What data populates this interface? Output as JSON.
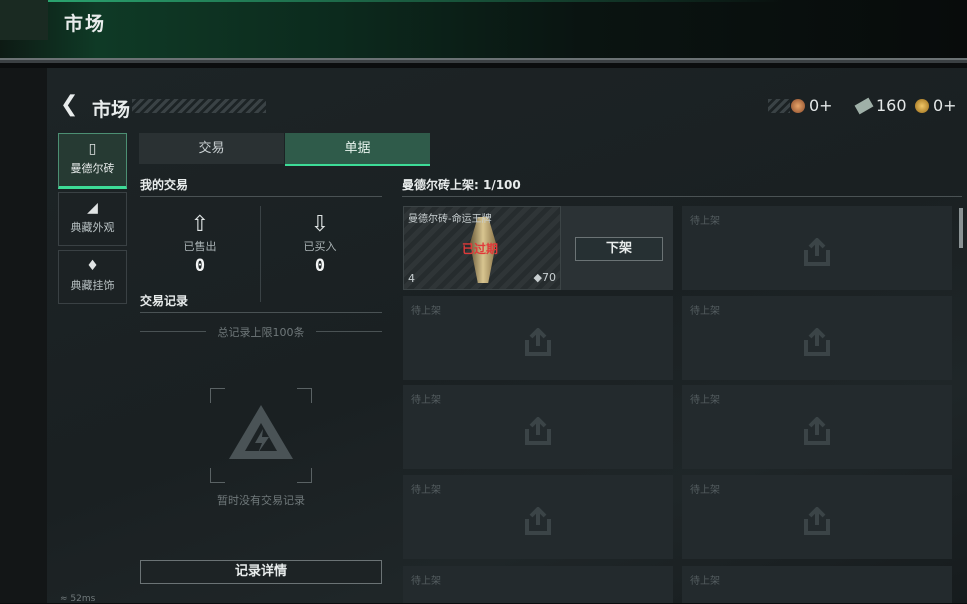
{
  "top": {
    "title": "市场"
  },
  "header": {
    "title": "市场"
  },
  "currency": [
    {
      "icon": "medal-coin-icon",
      "value": "0+"
    },
    {
      "icon": "ticket-icon",
      "value": "160"
    },
    {
      "icon": "gold-coin-icon",
      "value": "0+"
    }
  ],
  "sidebar": {
    "items": [
      {
        "label": "曼德尔砖",
        "icon": "brick-icon"
      },
      {
        "label": "典藏外观",
        "icon": "pistol-icon"
      },
      {
        "label": "典藏挂饰",
        "icon": "charm-icon"
      }
    ]
  },
  "tabs": [
    {
      "label": "交易"
    },
    {
      "label": "单据"
    }
  ],
  "my_trades": {
    "title": "我的交易",
    "sold_label": "已售出",
    "sold_value": "0",
    "bought_label": "已买入",
    "bought_value": "0"
  },
  "records": {
    "title": "交易记录",
    "limit": "总记录上限100条",
    "empty": "暂时没有交易记录",
    "detail_button": "记录详情"
  },
  "listings": {
    "title": "曼德尔砖上架: 1/100",
    "item": {
      "name": "曼德尔砖-命运王牌",
      "status": "已过期",
      "quantity": "4",
      "price": "70",
      "unlist_label": "下架"
    },
    "empty_slot_label": "待上架"
  },
  "status_bar": {
    "ping": "52ms"
  }
}
